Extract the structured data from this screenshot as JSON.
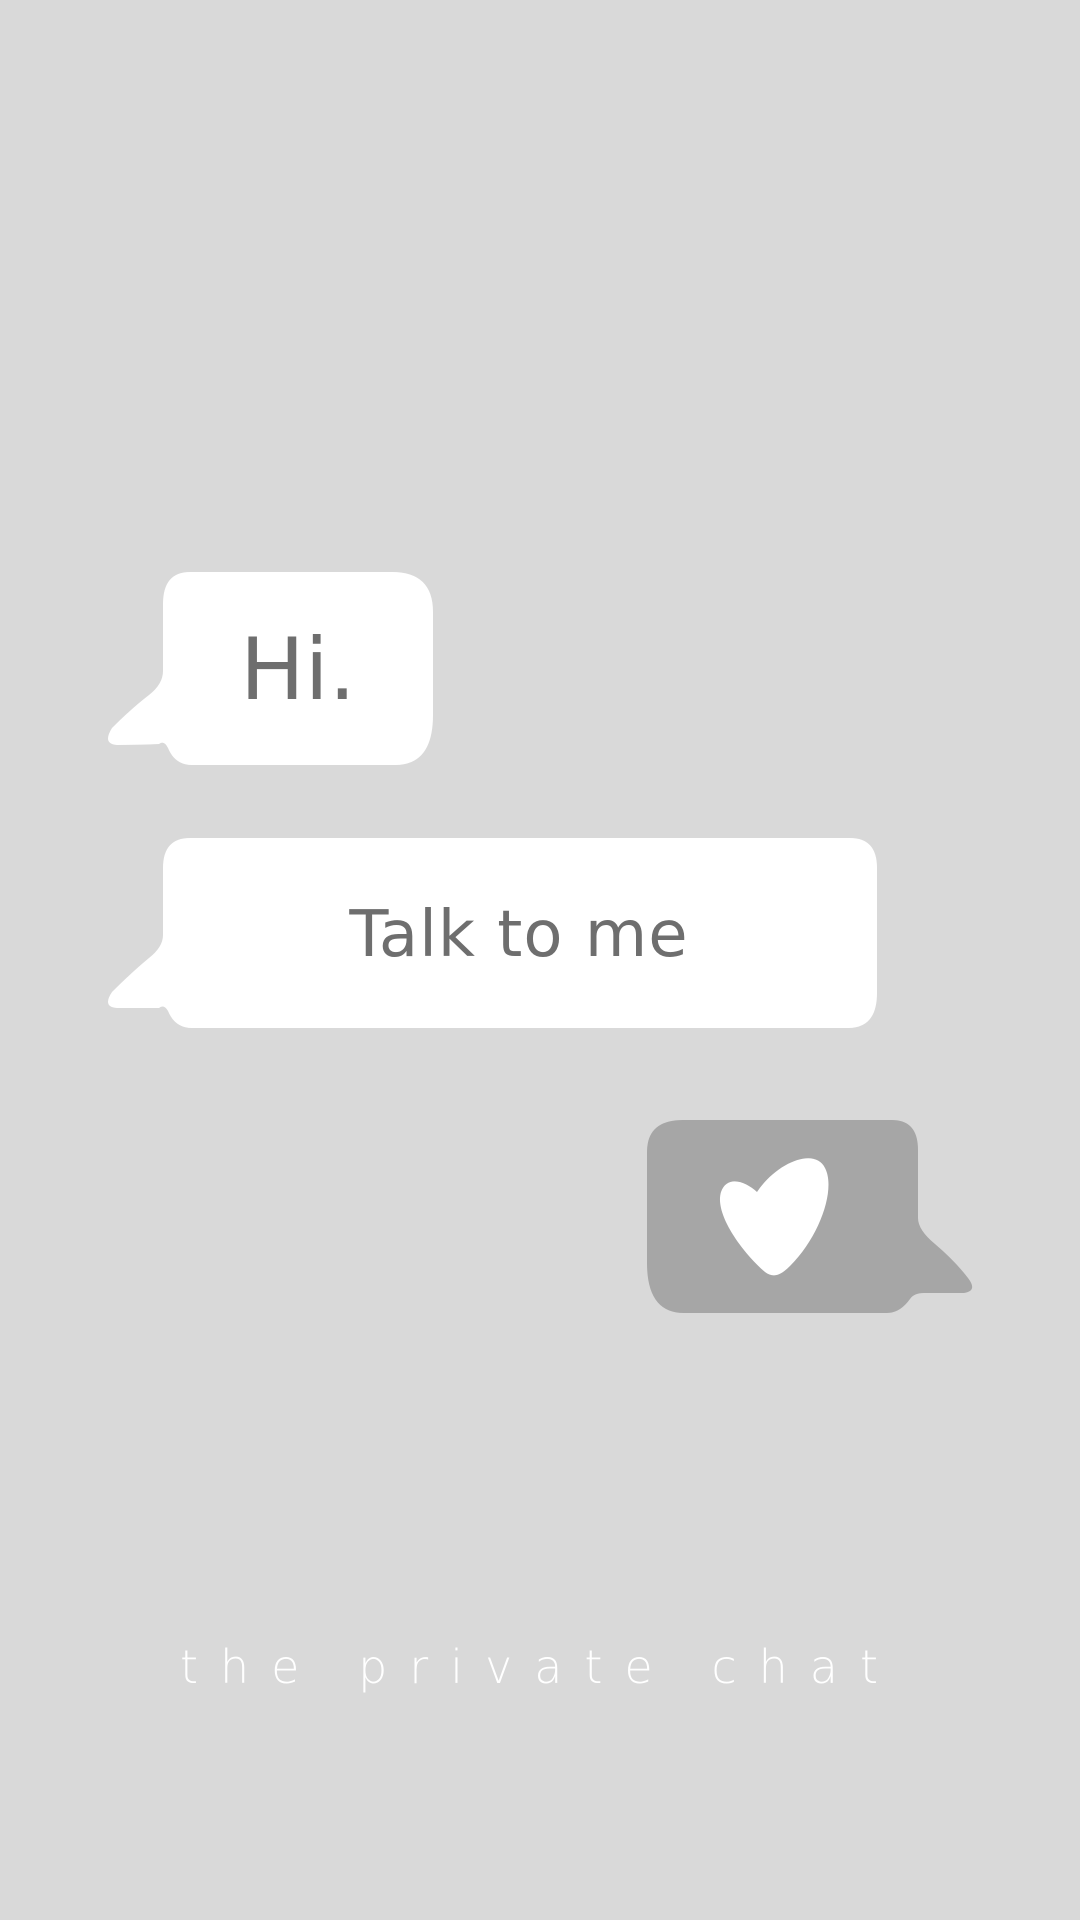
{
  "messages": [
    {
      "id": "hi",
      "text": "Hi."
    },
    {
      "id": "talk",
      "text": "Talk to me"
    },
    {
      "id": "heart",
      "icon": "heart-icon"
    }
  ],
  "footer": {
    "text": "the private chat"
  },
  "colors": {
    "background": "#d9d9d9",
    "incoming_bubble": "#ffffff",
    "outgoing_bubble": "#a6a6a6",
    "bubble_text": "#6e6e6e",
    "footer_text": "#ffffff"
  }
}
